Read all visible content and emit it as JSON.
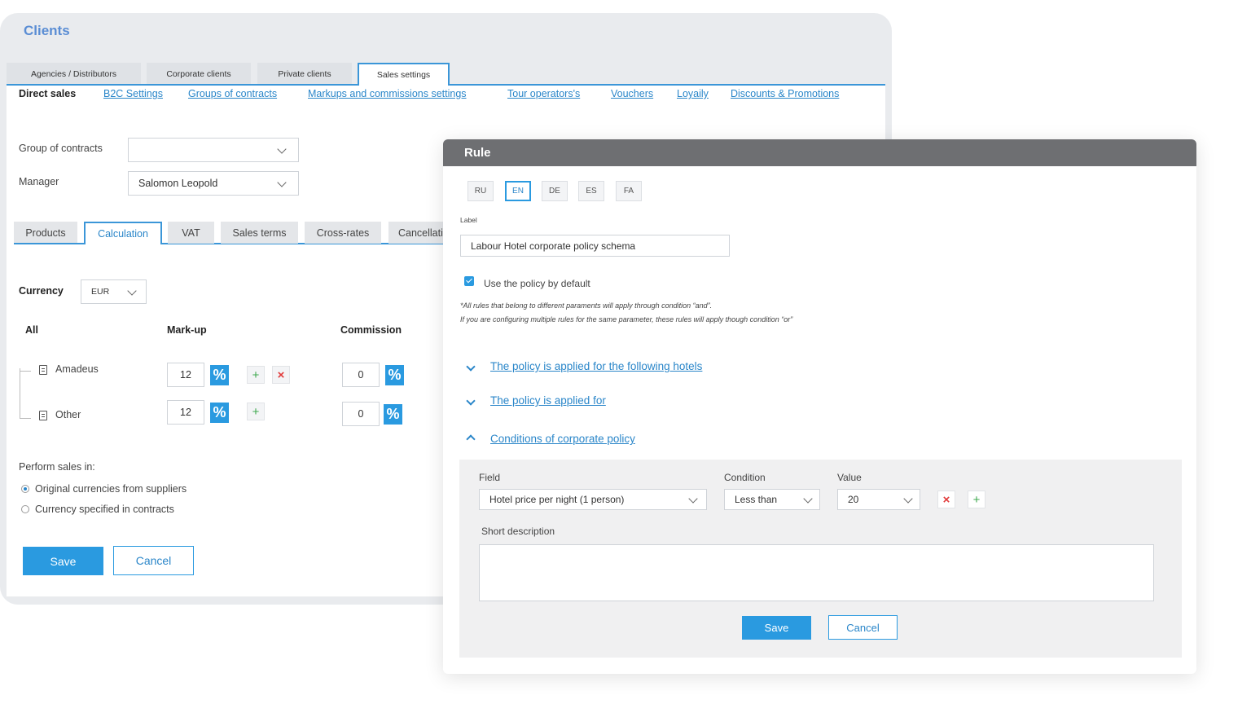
{
  "clients": {
    "title": "Clients",
    "top_tabs": [
      "Agencies / Distributors",
      "Corporate clients",
      "Private clients",
      "Sales settings"
    ],
    "nav": {
      "direct_sales": "Direct sales",
      "links": [
        "B2C Settings",
        "Groups of contracts",
        "Markups and commissions settings",
        "Tour operators's",
        "Vouchers",
        "Loyaily",
        "Discounts & Promotions"
      ]
    },
    "group_of_contracts": {
      "label": "Group of contracts",
      "value": ""
    },
    "manager": {
      "label": "Manager",
      "value": "Salomon Leopold"
    },
    "sub_tabs": [
      "Products",
      "Calculation",
      "VAT",
      "Sales terms",
      "Cross-rates",
      "Cancellati"
    ],
    "currency": {
      "label": "Currency",
      "value": "EUR"
    },
    "table": {
      "col_all": "All",
      "col_markup": "Mark-up",
      "col_commission": "Commission",
      "rows": [
        {
          "name": "Amadeus",
          "markup": "12",
          "commission": "0"
        },
        {
          "name": "Other",
          "markup": "12",
          "commission": "0"
        }
      ]
    },
    "perform_sales": {
      "label": "Perform sales in:",
      "options": [
        "Original currencies from suppliers",
        "Currency specified in contracts"
      ],
      "selected": 0
    },
    "save_label": "Save",
    "cancel_label": "Cancel"
  },
  "rule": {
    "title": "Rule",
    "languages": [
      "RU",
      "EN",
      "DE",
      "ES",
      "FA"
    ],
    "active_language": "EN",
    "label_caption": "Label",
    "label_value": "Labour Hotel corporate policy schema",
    "default_checkbox": "Use the policy by default",
    "default_checked": true,
    "note_line1": "*All rules that belong to different paraments will apply through condition “and”.",
    "note_line2": "If you are configuring multiple rules for the same parameter, these rules will apply though condition “or”",
    "sections": [
      {
        "label": "The policy is applied for the following hotels",
        "expanded": false
      },
      {
        "label": "The policy is applied for",
        "expanded": false
      },
      {
        "label": "Conditions of corporate policy",
        "expanded": true
      }
    ],
    "condition": {
      "field_label": "Field",
      "field_value": "Hotel price per night (1 person)",
      "condition_label": "Condition",
      "condition_value": "Less than",
      "value_label": "Value",
      "value_value": "20",
      "short_description_label": "Short description",
      "short_description_value": "",
      "save_label": "Save",
      "cancel_label": "Cancel"
    }
  },
  "colors": {
    "accent": "#2a9ae0",
    "link": "#2a86c9",
    "title": "#5a8dd4",
    "modal_header": "#6e6f72"
  }
}
